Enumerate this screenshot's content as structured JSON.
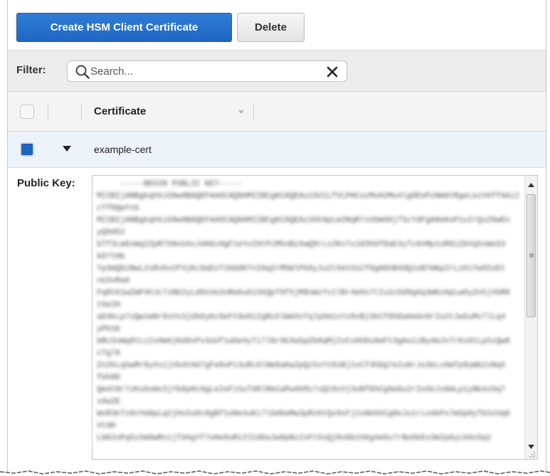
{
  "toolbar": {
    "create_label": "Create HSM Client Certificate",
    "delete_label": "Delete"
  },
  "filter": {
    "label": "Filter:",
    "placeholder": "Search...",
    "value": ""
  },
  "table": {
    "columns": [
      "Certificate"
    ],
    "rows": [
      {
        "name": "example-cert",
        "selected": true,
        "expanded": true
      }
    ]
  },
  "detail": {
    "public_key_label": "Public Key:"
  },
  "colors": {
    "primary": "#1f66c1",
    "selected_row": "#eef3fa",
    "filter_bar": "#ececec"
  },
  "icons": {
    "search": "search-icon",
    "clear": "close-icon",
    "expand": "caret-down-icon",
    "sort": "sort-caret-icon"
  }
}
